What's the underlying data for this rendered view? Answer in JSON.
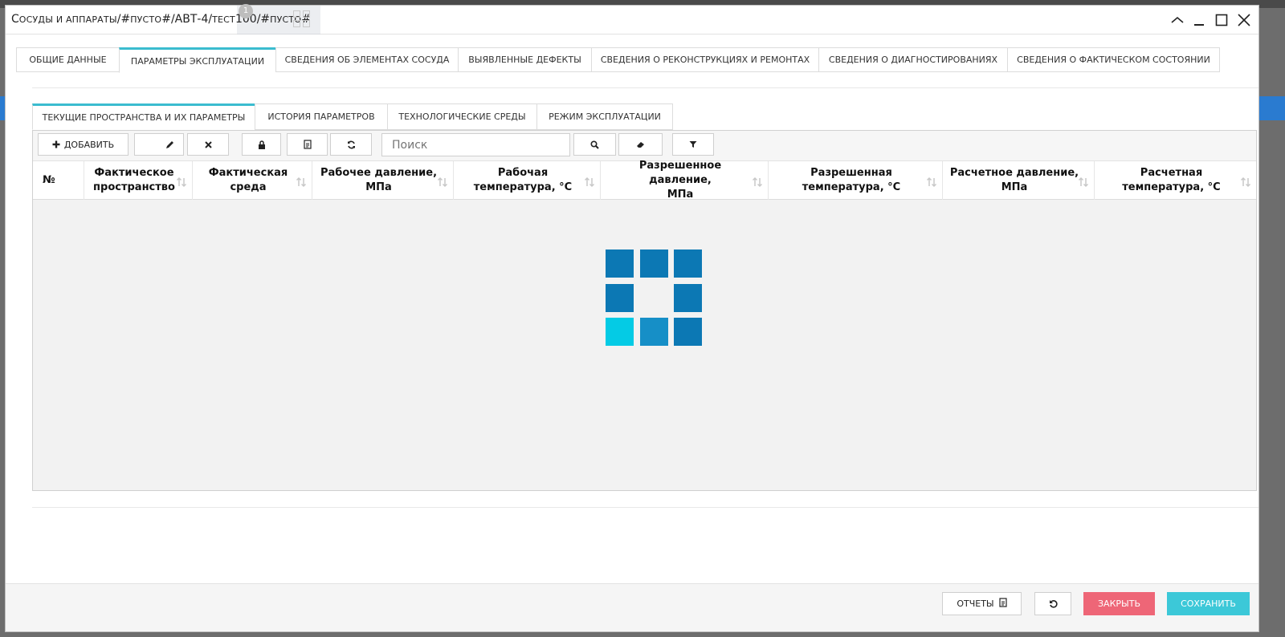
{
  "window": {
    "title_parts": {
      "p1": "С",
      "p2": "осуды и аппараты",
      "p3": "/#",
      "p4": "пусто",
      "p5": "#/АВТ-4/",
      "p6": "тест",
      "p7": "100/#",
      "p8": "пусто",
      "p9": "#"
    },
    "badge": "1",
    "controls": [
      "collapse-icon",
      "minimize-icon",
      "maximize-icon",
      "close-icon"
    ]
  },
  "main_tabs": [
    {
      "label": "Общие данные",
      "active": false
    },
    {
      "label": "Параметры эксплуатации",
      "active": true
    },
    {
      "label": "Сведения об элементах сосуда",
      "active": false
    },
    {
      "label": "Выявленные дефекты",
      "active": false
    },
    {
      "label": "Сведения о реконструкциях и ремонтах",
      "active": false
    },
    {
      "label": "Сведения о диагностированиях",
      "active": false
    },
    {
      "label": "Сведения о фактическом состоянии",
      "active": false
    }
  ],
  "sub_tabs": [
    {
      "label": "Текущие пространства и их параметры",
      "active": true
    },
    {
      "label": "История параметров",
      "active": false
    },
    {
      "label": "Технологические среды",
      "active": false
    },
    {
      "label": "Режим эксплуатации",
      "active": false
    }
  ],
  "toolbar": {
    "add_label": "Добавить",
    "search_placeholder": "Поиск",
    "icons": [
      "plus-icon",
      "pencil-icon",
      "times-icon",
      "lock-icon",
      "document-icon",
      "refresh-icon",
      "search-icon",
      "eraser-icon",
      "filter-icon"
    ]
  },
  "table": {
    "columns": [
      {
        "line1": "№",
        "line2": "",
        "sortable": false
      },
      {
        "line1": "Фактическое",
        "line2": "пространство",
        "sortable": true
      },
      {
        "line1": "Фактическая",
        "line2": "среда",
        "sortable": true
      },
      {
        "line1": "Рабочее давление,",
        "line2": "МПа",
        "sortable": true
      },
      {
        "line1": "Рабочая",
        "line2": "температура, °С",
        "sortable": true
      },
      {
        "line1": "Разрешенное давление,",
        "line2": "МПа",
        "sortable": true
      },
      {
        "line1": "Разрешенная",
        "line2": "температура, °С",
        "sortable": true
      },
      {
        "line1": "Расчетное давление,",
        "line2": "МПа",
        "sortable": true
      },
      {
        "line1": "Расчетная",
        "line2": "температура, °С",
        "sortable": true
      }
    ],
    "rows": [],
    "loading": true
  },
  "colors": {
    "accent_tab": "#3bbccf",
    "spinner_dark": "#0c78b4",
    "spinner_mid": "#168fc7",
    "spinner_light": "#04cbe5",
    "close_button": "#ee6677",
    "save_button": "#3cc8d8"
  },
  "footer": {
    "reports_label": "Отчеты",
    "close_label": "Закрыть",
    "save_label": "Сохранить"
  }
}
